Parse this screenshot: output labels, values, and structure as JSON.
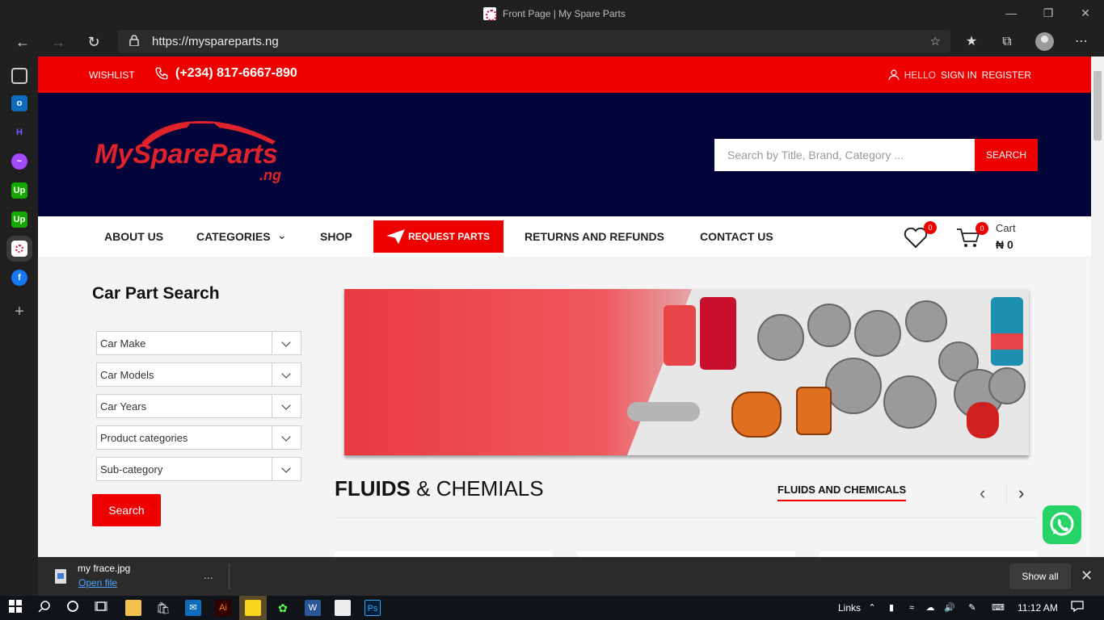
{
  "browser": {
    "tab_title": "Front Page | My Spare Parts",
    "url": "https://mysparepartsng",
    "url_display": "https://myspareparts.ng"
  },
  "topbar": {
    "wishlist": "WISHLIST",
    "phone": "(+234) 817-6667-890",
    "hello": "HELLO",
    "sign_in": "SIGN IN",
    "register": "REGISTER"
  },
  "header": {
    "logo_text": "MySpareParts",
    "logo_suffix": ".ng",
    "search_placeholder": "Search by Title, Brand, Category ...",
    "search_button": "SEARCH"
  },
  "nav": {
    "items": [
      "ABOUT US",
      "CATEGORIES",
      "SHOP",
      "REQUEST PARTS",
      "RETURNS AND REFUNDS",
      "CONTACT US"
    ],
    "wishlist_count": "0",
    "cart_count": "0",
    "cart_label": "Cart",
    "cart_total": "₦ 0"
  },
  "car_part_search": {
    "title": "Car Part Search",
    "selects": [
      "Car Make",
      "Car Models",
      "Car Years",
      "Product categories",
      "Sub-category"
    ],
    "button": "Search"
  },
  "section": {
    "title_bold": "FLUIDS",
    "title_rest": "& CHEMIALS",
    "tab": "FLUIDS AND CHEMICALS"
  },
  "downloads": {
    "file_name": "my frace.jpg",
    "open_file": "Open file",
    "more": "...",
    "show_all": "Show all"
  },
  "taskbar": {
    "links": "Links",
    "time": "11:12 AM"
  },
  "colors": {
    "brand_red": "#ee0000",
    "header_navy": "#03053a",
    "whatsapp_green": "#25d366"
  }
}
